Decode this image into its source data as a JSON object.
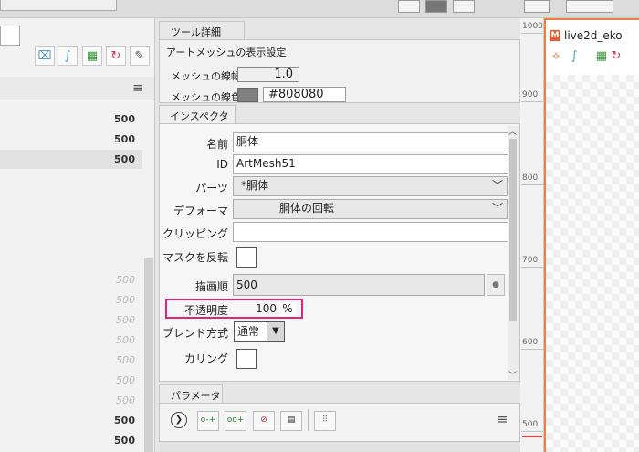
{
  "left_panel": {
    "rows": [
      {
        "value": "500",
        "faded": false
      },
      {
        "value": "500",
        "faded": false
      },
      {
        "value": "500",
        "faded": false
      },
      {
        "value": "500",
        "faded": true
      },
      {
        "value": "500",
        "faded": true
      },
      {
        "value": "500",
        "faded": true
      },
      {
        "value": "500",
        "faded": true
      },
      {
        "value": "500",
        "faded": true
      },
      {
        "value": "500",
        "faded": true
      },
      {
        "value": "500",
        "faded": true
      },
      {
        "value": "500",
        "faded": false
      },
      {
        "value": "500",
        "faded": false
      },
      {
        "value": "500",
        "faded": false
      }
    ],
    "menu_icon": "hamburger-menu-icon"
  },
  "tool_detail": {
    "tab_label": "ツール詳細",
    "section_title": "アートメッシュの表示設定",
    "line_width_label": "メッシュの線幅",
    "line_width_value": "1.0",
    "line_color_label": "メッシュの線色",
    "line_color_value": "#808080"
  },
  "inspector": {
    "tab_label": "インスペクタ",
    "name_label": "名前",
    "name_value": "胴体",
    "id_label": "ID",
    "id_value": "ArtMesh51",
    "parts_label": "パーツ",
    "parts_value": "*胴体",
    "deformer_label": "デフォーマ",
    "deformer_value": "胴体の回転",
    "clipping_label": "クリッピング",
    "clipping_value": "",
    "mask_invert_label": "マスクを反転",
    "draw_order_label": "描画順",
    "draw_order_value": "500",
    "opacity_label": "不透明度",
    "opacity_value": "100",
    "opacity_unit": "%",
    "blend_label": "ブレンド方式",
    "blend_value": "通常",
    "culling_label": "カリング",
    "highlight_color": "#e0257a"
  },
  "parameter": {
    "tab_label": "パラメータ"
  },
  "ruler": {
    "ticks": [
      "1000",
      "900",
      "800",
      "700",
      "600",
      "500"
    ]
  },
  "view": {
    "title": "live2d_eko",
    "accent_color": "#f08040"
  }
}
